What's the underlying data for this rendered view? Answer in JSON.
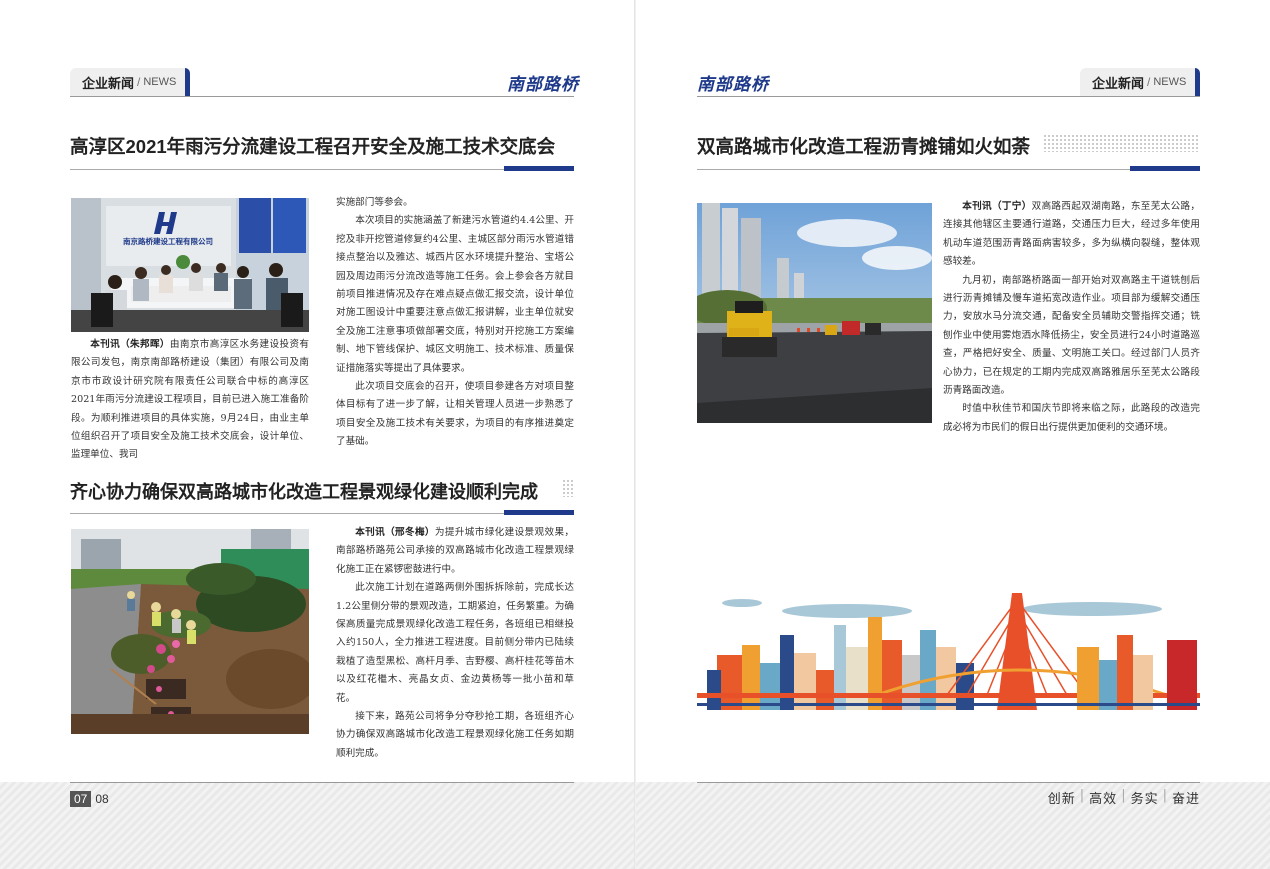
{
  "header": {
    "tab_cn": "企业新闻",
    "tab_sep": "/",
    "tab_en": "NEWS",
    "brand": "南部路桥",
    "accent_color": "#1f3a8a"
  },
  "left": {
    "article1": {
      "title": "高淳区2021年雨污分流建设工程召开安全及施工技术交底会",
      "photo_sign": "南京路桥建设工程有限公司",
      "byline": "本刊讯（朱邦晖）",
      "col1_lead": "由南京市高淳区水务建设投资有限公司发包，南京南部路桥建设（集团）有限公司及南京市市政设计研究院有限责任公司联合中标的高淳区2021年雨污分流建设工程项目，目前已进入施工准备阶段。为顺利推进项目的具体实施，9月24日，由业主单位组织召开了项目安全及施工技术交底会，设计单位、监理单位、我司",
      "col2_first": "实施部门等参会。",
      "col2_p2": "本次项目的实施涵盖了新建污水管道约4.4公里、开挖及非开挖管道修复约4公里、主城区部分雨污水管道错接点整治以及雅达、城西片区水环境提升整治、宝塔公园及周边雨污分流改造等施工任务。会上参会各方就目前项目推进情况及存在难点疑点做汇报交流，设计单位对施工图设计中重要注意点做汇报讲解，业主单位就安全及施工注意事项做部署交底，特别对开挖施工方案编制、地下管线保护、城区文明施工、技术标准、质量保证措施落实等提出了具体要求。",
      "col2_p3": "此次项目交底会的召开，使项目参建各方对项目整体目标有了进一步了解，让相关管理人员进一步熟悉了项目安全及施工技术有关要求，为项目的有序推进奠定了基础。"
    },
    "article2": {
      "title": "齐心协力确保双高路城市化改造工程景观绿化建设顺利完成",
      "byline": "本刊讯（邢冬梅）",
      "p1": "为提升城市绿化建设景观效果，南部路桥路苑公司承接的双高路城市化改造工程景观绿化施工正在紧锣密鼓进行中。",
      "p2": "此次施工计划在道路两侧外围拆拆除前，完成长达1.2公里侧分带的景观改造，工期紧迫，任务繁重。为确保高质量完成景观绿化改造工程任务，各班组已相继投入约150人，全力推进工程进度。目前侧分带内已陆续栽植了造型黑松、高杆月季、吉野樱、高杆桂花等苗木以及红花檵木、亮晶女贞、金边黄杨等一批小苗和草花。",
      "p3": "接下来，路苑公司将争分夺秒抢工期，各班组齐心协力确保双高路城市化改造工程景观绿化施工任务如期顺利完成。"
    }
  },
  "right": {
    "article3": {
      "title": "双高路城市化改造工程沥青摊铺如火如荼",
      "byline": "本刊讯（丁宁）",
      "p1": "双高路西起双湖南路，东至芜太公路，连接其他辖区主要通行道路，交通压力巨大，经过多年使用机动车道范围沥青路面病害较多，多为纵横向裂缝，整体观感较差。",
      "p2": "九月初，南部路桥路面一部开始对双高路主干道铣刨后进行沥青摊铺及慢车道拓宽改造作业。项目部为缓解交通压力，安放水马分流交通，配备安全员辅助交警指挥交通；铣刨作业中使用雾炮洒水降低扬尘，安全员进行24小时道路巡查，严格把好安全、质量、文明施工关口。经过部门人员齐心协力，已在规定的工期内完成双高路雅居乐至芜太公路段沥青路面改造。",
      "p3": "时值中秋佳节和国庆节即将来临之际，此路段的改造完成必将为市民们的假日出行提供更加便利的交通环境。"
    }
  },
  "footer": {
    "page_left": "07",
    "page_right": "08",
    "slogan": [
      "创新",
      "高效",
      "务实",
      "奋进"
    ]
  }
}
